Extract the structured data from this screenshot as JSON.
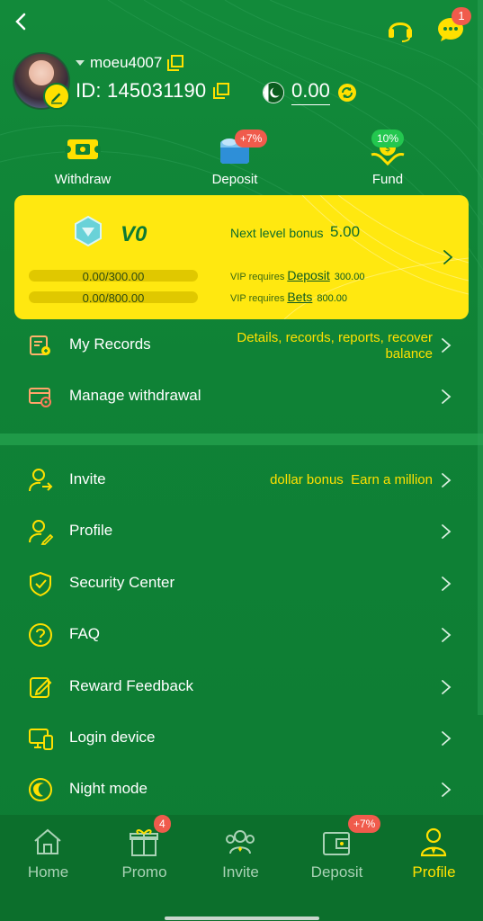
{
  "header": {
    "notification_count": "1"
  },
  "profile": {
    "username": "moeu4007",
    "id_label": "ID: 145031190",
    "balance": "0.00"
  },
  "actions": [
    {
      "label": "Withdraw",
      "badge": ""
    },
    {
      "label": "Deposit",
      "badge": "+7%"
    },
    {
      "label": "Fund",
      "badge": "10%"
    }
  ],
  "vip": {
    "level": "V0",
    "next_label": "Next level bonus",
    "next_value": "5.00",
    "deposit_progress": "0.00/300.00",
    "bets_progress": "0.00/800.00",
    "deposit_fraction": 0,
    "bets_fraction": 0,
    "req_prefix": "VIP requires",
    "deposit_link": "Deposit",
    "deposit_amount": "300.00",
    "bets_link": "Bets",
    "bets_amount": "800.00"
  },
  "records": {
    "my_records": "My Records",
    "my_records_hint_line1": "Details, records, reports, recover",
    "my_records_hint_line2": "balance",
    "manage_withdrawal": "Manage withdrawal"
  },
  "menu": {
    "invite": "Invite",
    "invite_hint": "dollar bonus  Earn a million",
    "profile": "Profile",
    "security": "Security Center",
    "faq": "FAQ",
    "reward_feedback": "Reward Feedback",
    "login_device": "Login device",
    "night_mode": "Night mode"
  },
  "tabs": [
    {
      "label": "Home",
      "badge": ""
    },
    {
      "label": "Promo",
      "badge": "4"
    },
    {
      "label": "Invite",
      "badge": ""
    },
    {
      "label": "Deposit",
      "badge": "+7%"
    },
    {
      "label": "Profile",
      "badge": ""
    }
  ],
  "colors": {
    "background": "#0f8236",
    "accent": "#ffe000",
    "badge": "#f05b4c",
    "vip_card": "#ffe810"
  },
  "icons": {
    "back": "chevron-left-icon",
    "support": "headset-icon",
    "chat": "chat-bubble-icon"
  }
}
